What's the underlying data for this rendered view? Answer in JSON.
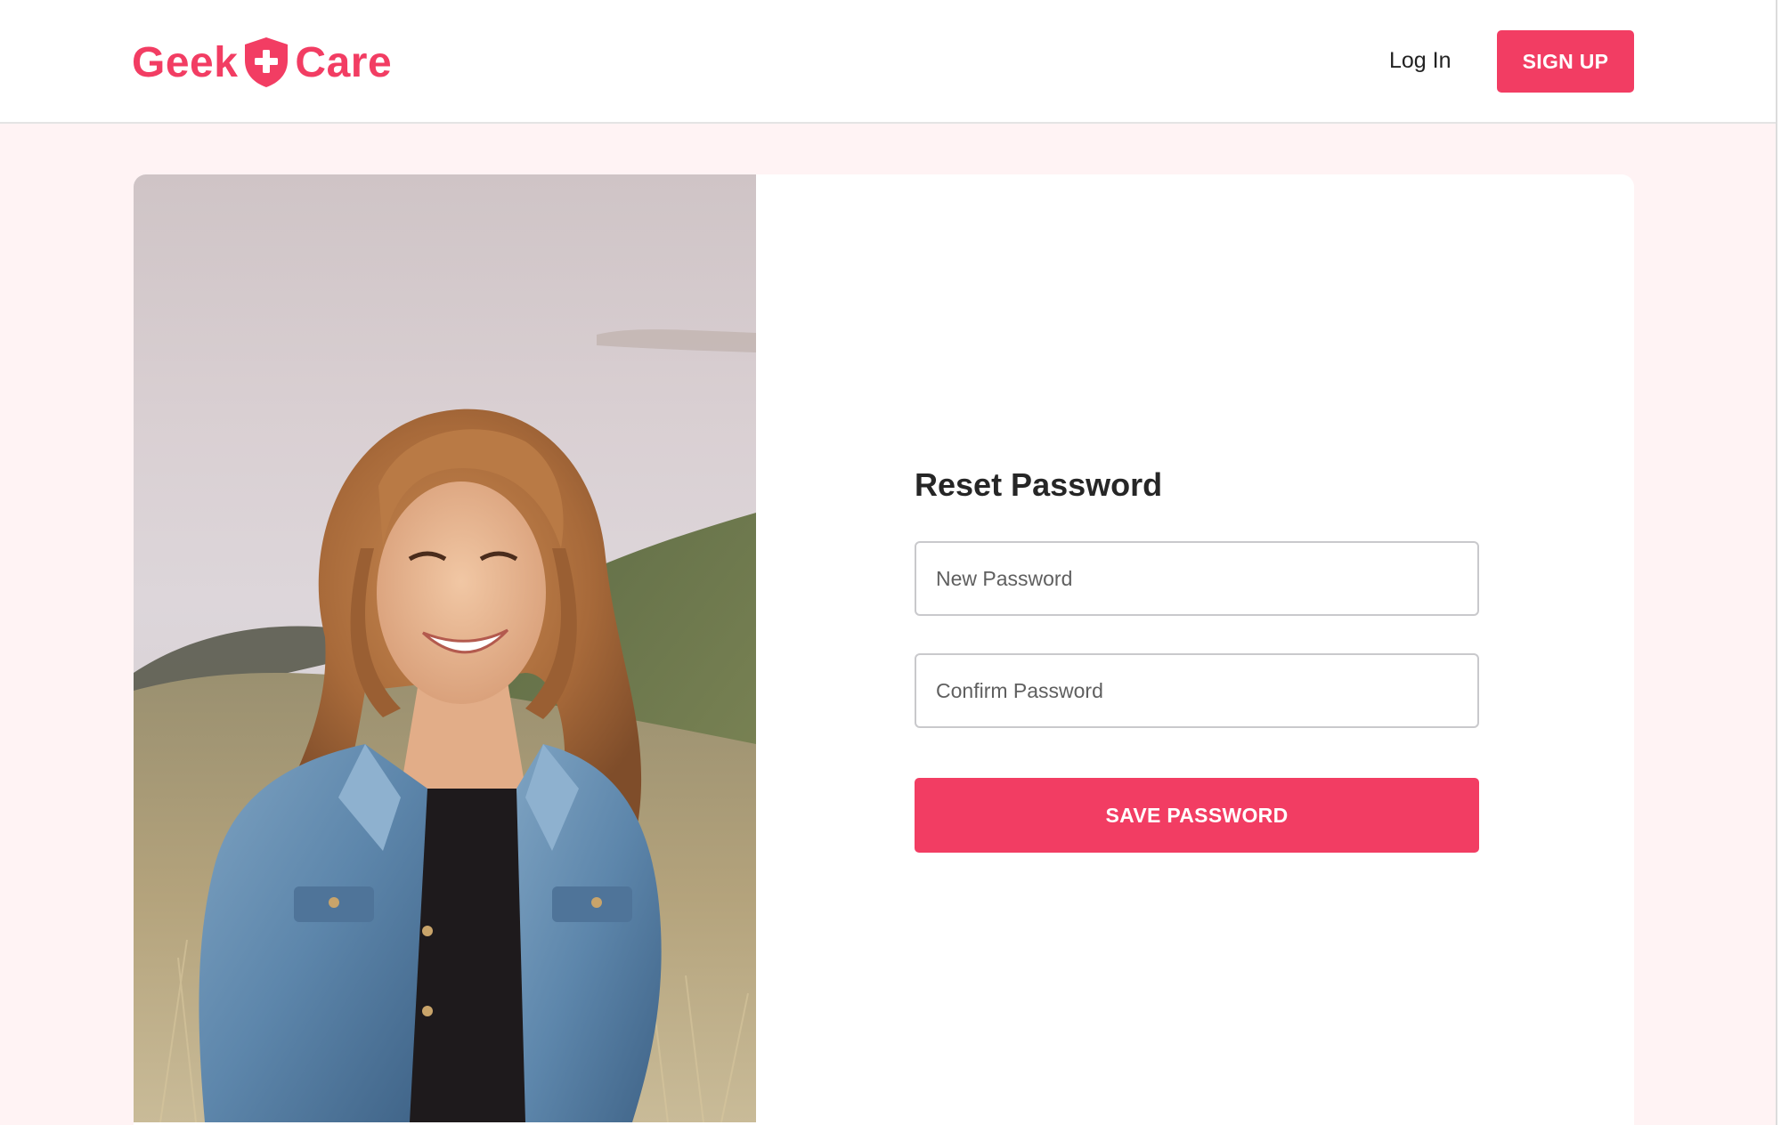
{
  "brand": {
    "name_left": "Geek",
    "name_right": "Care",
    "logo_icon": "shield-plus-icon",
    "color": "#f23d63"
  },
  "nav": {
    "login_label": "Log In",
    "signup_label": "SIGN UP"
  },
  "hero": {
    "photo": "smiling-woman-denim-jacket-photo"
  },
  "form": {
    "title": "Reset Password",
    "new_password": {
      "placeholder": "New Password",
      "value": ""
    },
    "confirm_password": {
      "placeholder": "Confirm Password",
      "value": ""
    },
    "submit_label": "SAVE PASSWORD"
  },
  "colors": {
    "accent": "#f23d63",
    "page_background": "#fff3f4",
    "card_background": "#ffffff",
    "input_border": "#c9c9cc"
  }
}
